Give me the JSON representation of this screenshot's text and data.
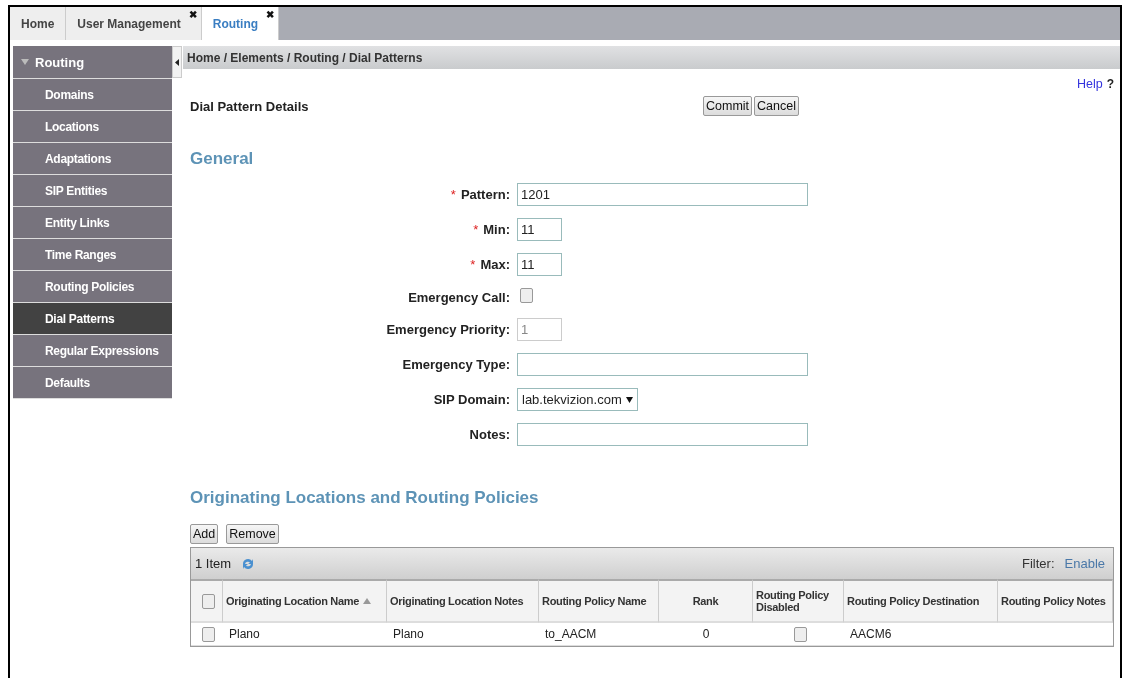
{
  "tabs": [
    {
      "label": "Home",
      "selected": false
    },
    {
      "label": "User Management",
      "selected": false,
      "close": "✖"
    },
    {
      "label": "Routing",
      "selected": true,
      "close": "✖"
    }
  ],
  "sidebar": {
    "title": "Routing",
    "expanded": true,
    "items": [
      {
        "label": "Domains",
        "selected": false
      },
      {
        "label": "Locations",
        "selected": false
      },
      {
        "label": "Adaptations",
        "selected": false
      },
      {
        "label": "SIP Entities",
        "selected": false
      },
      {
        "label": "Entity Links",
        "selected": false
      },
      {
        "label": "Time Ranges",
        "selected": false
      },
      {
        "label": "Routing Policies",
        "selected": false
      },
      {
        "label": "Dial Patterns",
        "selected": true
      },
      {
        "label": "Regular Expressions",
        "selected": false
      },
      {
        "label": "Defaults",
        "selected": false
      }
    ]
  },
  "breadcrumb": "Home / Elements / Routing / Dial Patterns",
  "help": {
    "label": "Help",
    "mark": "?"
  },
  "details_title": "Dial Pattern Details",
  "buttons": [
    "Commit",
    "Cancel"
  ],
  "general": {
    "heading": "General",
    "fields": [
      {
        "kind": "text",
        "label": "Pattern:",
        "marker": "*",
        "value": "1201"
      },
      {
        "kind": "number",
        "label": "Min:",
        "marker": "*",
        "value": "11"
      },
      {
        "kind": "number",
        "label": "Max:",
        "marker": "*",
        "value": "11"
      },
      {
        "kind": "checkbox",
        "label": "Emergency Call:",
        "checked": false
      },
      {
        "kind": "number",
        "label": "Emergency Priority:",
        "value": "1",
        "disabled": true
      },
      {
        "kind": "text",
        "label": "Emergency Type:"
      },
      {
        "kind": "select",
        "label": "SIP Domain:",
        "value": "lab.tekvizion.com"
      },
      {
        "kind": "text",
        "label": "Notes:"
      }
    ]
  },
  "policies": {
    "heading": "Originating Locations and Routing Policies",
    "buttons": [
      "Add",
      "Remove"
    ],
    "table": {
      "count": "1 Item",
      "filter_label": "Filter:",
      "filter_link": "Enable",
      "all_checked": false,
      "columns": [
        {
          "label": "Originating Location Name",
          "sorted": true
        },
        {
          "label": "Originating Location Notes",
          "sorted": false
        },
        {
          "label": "Routing Policy Name",
          "sorted": false
        },
        {
          "label": "Rank",
          "sorted": false
        },
        {
          "label": "Routing Policy Disabled",
          "sorted": false
        },
        {
          "label": "Routing Policy Destination",
          "sorted": false
        },
        {
          "label": "Routing Policy Notes",
          "sorted": false
        }
      ],
      "rows": [
        {
          "selected": false,
          "location_name": "Plano",
          "location_notes": "Plano",
          "policy_name": "to_AACM",
          "rank": "0",
          "policy_disabled": false,
          "destination": "AACM6"
        }
      ]
    }
  }
}
